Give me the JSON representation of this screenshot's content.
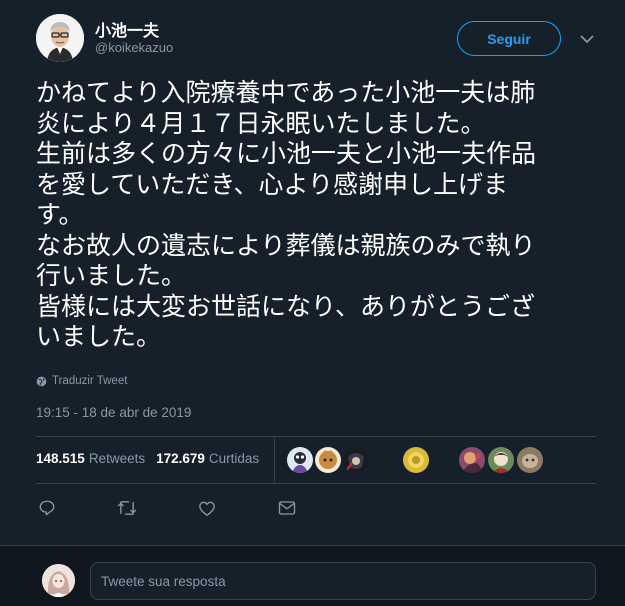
{
  "author": {
    "name": "小池一夫",
    "handle": "@koikekazuo",
    "avatar_icon": "man-with-glasses-avatar"
  },
  "follow_button": {
    "label": "Seguir",
    "color": "#1da1f2"
  },
  "more_menu": {
    "icon": "chevron-down-icon"
  },
  "tweet": {
    "lines": [
      "かねてより入院療養中であった小池一夫は肺",
      "炎により４月１７日永眠いたしました。",
      "生前は多くの方々に小池一夫と小池一夫作品",
      "を愛していただき、心より感謝申し上げま",
      "す。",
      "なお故人の遺志により葬儀は親族のみで執り",
      "行いました。",
      "皆様には大変お世話になり、ありがとうござ",
      "いました。"
    ],
    "translate_label": "Traduzir Tweet",
    "timestamp": "19:15 - 18 de abr de 2019"
  },
  "stats": {
    "retweets_count": "148.515",
    "retweets_label": "Retweets",
    "likes_count": "172.679",
    "likes_label": "Curtidas"
  },
  "likers": [
    {
      "icon": "liker-avatar-1",
      "color": "#dfe7f0"
    },
    {
      "icon": "liker-avatar-2",
      "color": "#c98a3c"
    },
    {
      "icon": "liker-avatar-3",
      "color": "#1a1a22"
    },
    {
      "icon": "liker-avatar-4",
      "color": "#d9b93a"
    },
    {
      "icon": "liker-avatar-5",
      "color": "#8a4a6a"
    },
    {
      "icon": "liker-avatar-6",
      "color": "#6e8a5a"
    },
    {
      "icon": "liker-avatar-7",
      "color": "#8c7a66"
    }
  ],
  "actions": [
    {
      "icon": "reply-icon"
    },
    {
      "icon": "retweet-icon"
    },
    {
      "icon": "like-heart-icon"
    },
    {
      "icon": "direct-message-icon"
    }
  ],
  "reply_box": {
    "placeholder": "Tweete sua resposta",
    "avatar_icon": "user-avatar"
  },
  "colors": {
    "background": "#15202b",
    "secondary_text": "#8899a6",
    "border": "#38444d",
    "accent": "#1da1f2"
  }
}
